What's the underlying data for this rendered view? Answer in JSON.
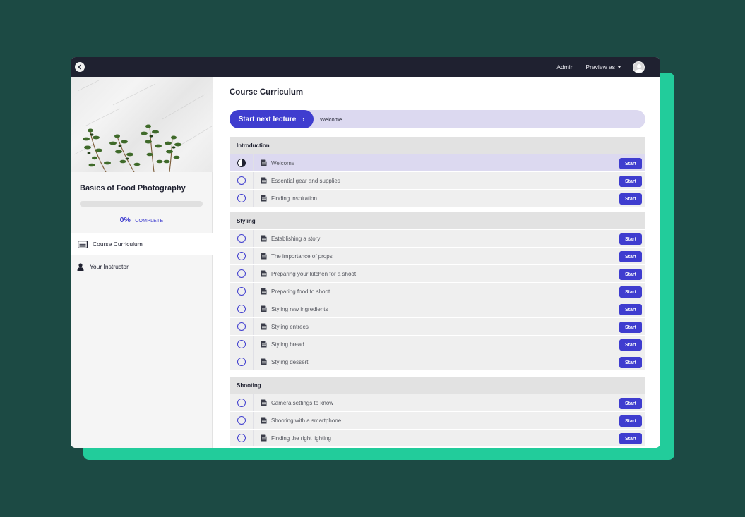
{
  "colors": {
    "page_background": "#1c4a44",
    "backdrop_accent": "#22cc9b",
    "topbar": "#1f2130",
    "primary": "#3f3dcf",
    "highlight": "#dcd9f0"
  },
  "topbar": {
    "back_icon": "chevron-left-icon",
    "admin_label": "Admin",
    "preview_label": "Preview as",
    "avatar_icon": "user-avatar-icon"
  },
  "sidebar": {
    "course_title": "Basics of Food Photography",
    "progress_percent": 0,
    "progress_label": "0%",
    "complete_label": "COMPLETE",
    "nav": [
      {
        "label": "Course Curriculum",
        "icon": "list-icon",
        "active": true
      },
      {
        "label": "Your Instructor",
        "icon": "user-icon",
        "active": false
      }
    ]
  },
  "main": {
    "title": "Course Curriculum",
    "next_lecture_button": "Start next lecture",
    "next_lecture_chevron": "›",
    "next_lecture_title": "Welcome",
    "start_label": "Start",
    "sections": [
      {
        "title": "Introduction",
        "lectures": [
          {
            "title": "Welcome",
            "status": "in-progress"
          },
          {
            "title": "Essential gear and supplies",
            "status": "not-started"
          },
          {
            "title": "Finding inspiration",
            "status": "not-started"
          }
        ]
      },
      {
        "title": "Styling",
        "lectures": [
          {
            "title": "Establishing a story",
            "status": "not-started"
          },
          {
            "title": "The importance of props",
            "status": "not-started"
          },
          {
            "title": "Preparing your kitchen for a shoot",
            "status": "not-started"
          },
          {
            "title": "Preparing food to shoot",
            "status": "not-started"
          },
          {
            "title": "Styling raw ingredients",
            "status": "not-started"
          },
          {
            "title": "Styling entrees",
            "status": "not-started"
          },
          {
            "title": "Styling bread",
            "status": "not-started"
          },
          {
            "title": "Styling dessert",
            "status": "not-started"
          }
        ]
      },
      {
        "title": "Shooting",
        "lectures": [
          {
            "title": "Camera settings to know",
            "status": "not-started"
          },
          {
            "title": "Shooting with a smartphone",
            "status": "not-started"
          },
          {
            "title": "Finding the right lighting",
            "status": "not-started"
          }
        ]
      }
    ]
  }
}
